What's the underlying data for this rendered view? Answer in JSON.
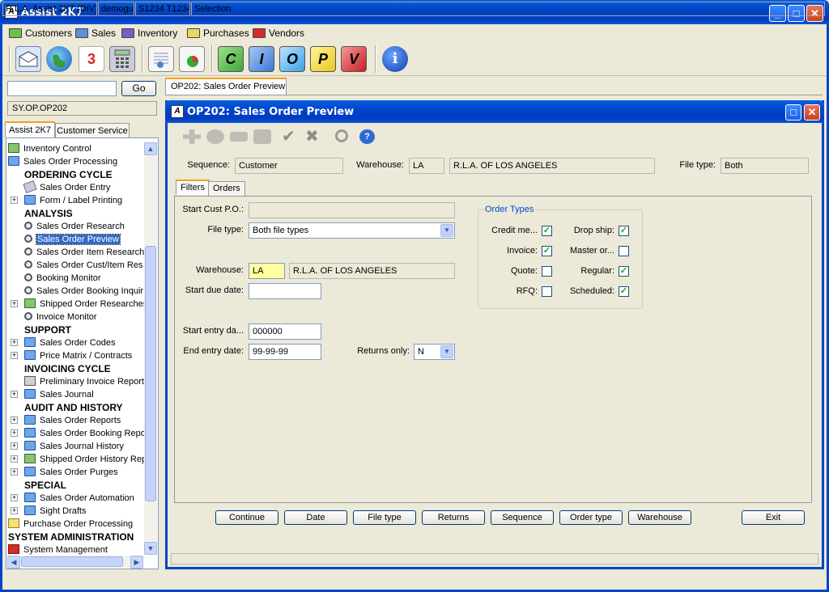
{
  "app": {
    "title": "Assist 2K7"
  },
  "menu": [
    {
      "label": "Customers",
      "color": "#6fbf4a"
    },
    {
      "label": "Sales",
      "color": "#5b8fdc"
    },
    {
      "label": "Inventory",
      "color": "#7b5bc7"
    },
    {
      "label": "Purchases",
      "color": "#e9d85a"
    },
    {
      "label": "Vendors",
      "color": "#d62b2b"
    }
  ],
  "toolbar": {
    "icons": [
      "mail-icon",
      "globe-icon",
      "calendar-icon",
      "calculator-icon",
      "document-icon",
      "chart-report-icon",
      "c-icon",
      "i-icon",
      "o-icon",
      "p-icon",
      "v-icon",
      "info-icon"
    ],
    "letters": {
      "c": "C",
      "i": "I",
      "o": "O",
      "p": "P",
      "v": "V",
      "calendar_day": "3",
      "info": "i"
    }
  },
  "left": {
    "go_label": "Go",
    "search_value": "",
    "path_value": "SY.OP.OP202",
    "tabs": [
      "Assist 2K7",
      "Customer Service"
    ],
    "tree": [
      {
        "label": "Inventory Control",
        "icon": "greenfolder",
        "level": 0
      },
      {
        "label": "Sales Order Processing",
        "icon": "folder",
        "level": 0
      },
      {
        "label": "ORDERING CYCLE",
        "head": true,
        "level": 1
      },
      {
        "label": "Sales Order Entry",
        "icon": "pen",
        "level": 2
      },
      {
        "label": "Form / Label Printing",
        "icon": "folder",
        "level": 2,
        "expand": true
      },
      {
        "label": "ANALYSIS",
        "head": true,
        "level": 1
      },
      {
        "label": "Sales Order Research",
        "icon": "mag",
        "level": 2
      },
      {
        "label": "Sales Order Preview",
        "icon": "mag",
        "level": 2,
        "selected": true
      },
      {
        "label": "Sales Order Item Research",
        "icon": "mag",
        "level": 2
      },
      {
        "label": "Sales Order Cust/Item Res",
        "icon": "mag",
        "level": 2
      },
      {
        "label": "Booking Monitor",
        "icon": "mag",
        "level": 2
      },
      {
        "label": "Sales Order Booking Inquir",
        "icon": "mag",
        "level": 2
      },
      {
        "label": "Shipped Order Researches",
        "icon": "greenfolder",
        "level": 2,
        "expand": true
      },
      {
        "label": "Invoice Monitor",
        "icon": "mag",
        "level": 2
      },
      {
        "label": "SUPPORT",
        "head": true,
        "level": 1
      },
      {
        "label": "Sales Order Codes",
        "icon": "folder",
        "level": 2,
        "expand": true
      },
      {
        "label": "Price Matrix / Contracts",
        "icon": "folder",
        "level": 2,
        "expand": true
      },
      {
        "label": "INVOICING CYCLE",
        "head": true,
        "level": 1
      },
      {
        "label": "Preliminary Invoice Report",
        "icon": "printer",
        "level": 2
      },
      {
        "label": "Sales Journal",
        "icon": "folder",
        "level": 2,
        "expand": true
      },
      {
        "label": "AUDIT AND HISTORY",
        "head": true,
        "level": 1
      },
      {
        "label": "Sales Order Reports",
        "icon": "folder",
        "level": 2,
        "expand": true
      },
      {
        "label": "Sales Order Booking Repor",
        "icon": "folder",
        "level": 2,
        "expand": true
      },
      {
        "label": "Sales Journal History",
        "icon": "folder",
        "level": 2,
        "expand": true
      },
      {
        "label": "Shipped Order History Rep",
        "icon": "greenfolder",
        "level": 2,
        "expand": true
      },
      {
        "label": "Sales Order Purges",
        "icon": "folder",
        "level": 2,
        "expand": true
      },
      {
        "label": "SPECIAL",
        "head": true,
        "level": 1
      },
      {
        "label": "Sales Order Automation",
        "icon": "folder",
        "level": 2,
        "expand": true
      },
      {
        "label": "Sight Drafts",
        "icon": "folder",
        "level": 2,
        "expand": true
      },
      {
        "label": "Purchase Order Processing",
        "icon": "yellowfolder",
        "level": 0
      },
      {
        "label": "SYSTEM ADMINISTRATION",
        "head": true,
        "level": -1
      },
      {
        "label": "System Management",
        "icon": "redfolder",
        "level": 0
      }
    ]
  },
  "doc_tab": "OP202: Sales Order Preview",
  "window": {
    "title": "OP202: Sales Order Preview",
    "header": {
      "sequence_label": "Sequence:",
      "sequence_value": "Customer",
      "warehouse_label": "Warehouse:",
      "warehouse_code": "LA",
      "warehouse_name": "R.L.A. OF LOS ANGELES",
      "filetype_label": "File type:",
      "filetype_value": "Both"
    },
    "tabs": [
      "Filters",
      "Orders"
    ],
    "filters": {
      "start_po_label": "Start Cust P.O.:",
      "start_po_value": "",
      "filetype_label": "File type:",
      "filetype_value": "Both file types",
      "warehouse_label": "Warehouse:",
      "warehouse_code": "LA",
      "warehouse_name": "R.L.A. OF LOS ANGELES",
      "start_due_label": "Start due date:",
      "start_due_value": "",
      "start_entry_label": "Start entry da...",
      "start_entry_value": "000000",
      "end_entry_label": "End entry date:",
      "end_entry_value": "99-99-99",
      "returns_label": "Returns only:",
      "returns_value": "N"
    },
    "order_types": {
      "title": "Order Types",
      "left": [
        {
          "label": "Credit me...",
          "checked": true
        },
        {
          "label": "Invoice:",
          "checked": true
        },
        {
          "label": "Quote:",
          "checked": false
        },
        {
          "label": "RFQ:",
          "checked": false
        }
      ],
      "right": [
        {
          "label": "Drop ship:",
          "checked": true
        },
        {
          "label": "Master or...",
          "checked": false
        },
        {
          "label": "Regular:",
          "checked": true
        },
        {
          "label": "Scheduled:",
          "checked": true
        }
      ]
    },
    "buttons": [
      "Continue",
      "Date",
      "File type",
      "Returns",
      "Sequence",
      "Order type",
      "Warehouse"
    ],
    "exit_label": "Exit"
  },
  "status": [
    "R.L.A. Assist 2K7 (DIV)",
    "demogui",
    "S1234 T1234",
    "Selection:"
  ]
}
